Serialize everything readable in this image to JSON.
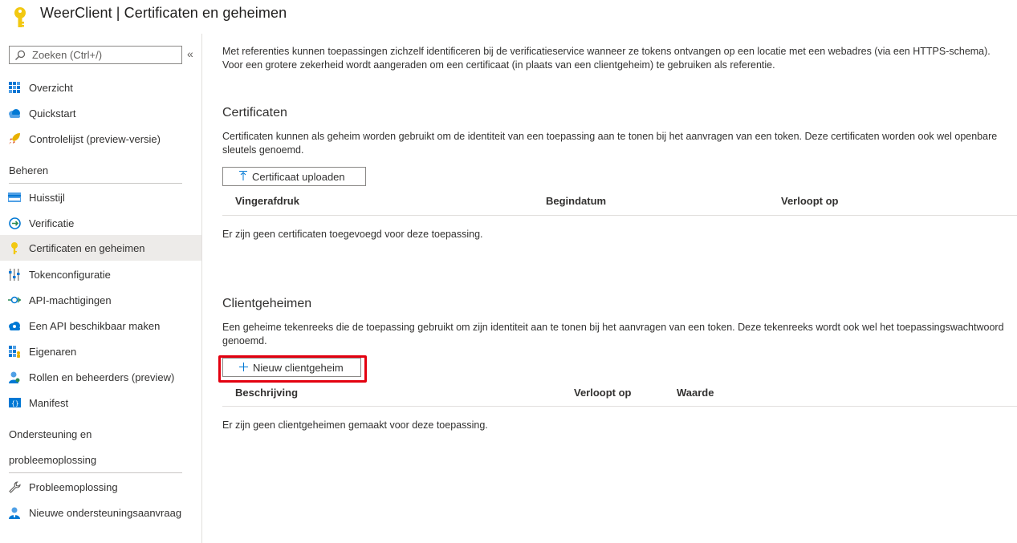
{
  "header": {
    "title": "WeerClient | Certificaten en geheimen",
    "icon": "key-icon",
    "icon_color": "#f2c811"
  },
  "sidebar": {
    "search_placeholder": "Zoeken (Ctrl+/)",
    "collapse_glyph": "«",
    "items_top": [
      {
        "label": "Overzicht",
        "icon": "grid-icon"
      },
      {
        "label": "Quickstart",
        "icon": "cloud-icon"
      },
      {
        "label": "Controlelijst (preview-versie)",
        "icon": "rocket-icon"
      }
    ],
    "section_manage": "Beheren",
    "items_manage": [
      {
        "label": "Huisstijl",
        "icon": "branding-icon"
      },
      {
        "label": "Verificatie",
        "icon": "verification-icon"
      },
      {
        "label": "Certificaten en geheimen",
        "icon": "key-icon",
        "active": true
      },
      {
        "label": "Tokenconfiguratie",
        "icon": "token-config-icon"
      },
      {
        "label": "API-machtigingen",
        "icon": "api-permissions-icon"
      },
      {
        "label": "Een API beschikbaar maken",
        "icon": "cloud-api-icon"
      },
      {
        "label": "Eigenaren",
        "icon": "owners-icon"
      },
      {
        "label": "Rollen en beheerders (preview)",
        "icon": "roles-icon"
      },
      {
        "label": "Manifest",
        "icon": "manifest-icon"
      }
    ],
    "section_support_line1": "Ondersteuning en",
    "section_support_line2": "probleemoplossing",
    "items_support": [
      {
        "label": "Probleemoplossing",
        "icon": "wrench-icon"
      },
      {
        "label": "Nieuwe ondersteuningsaanvraag",
        "icon": "support-person-icon"
      }
    ]
  },
  "main": {
    "intro": "Met referenties kunnen toepassingen zichzelf identificeren bij de verificatieservice wanneer ze tokens ontvangen op een locatie met een webadres (via een HTTPS-schema). Voor een grotere zekerheid wordt aangeraden om een certificaat (in plaats van een clientgeheim) te gebruiken als referentie.",
    "certificates": {
      "heading": "Certificaten",
      "description": "Certificaten kunnen als geheim worden gebruikt om de identiteit van een toepassing aan te tonen bij het aanvragen van een token. Deze certificaten worden ook wel openbare sleutels genoemd.",
      "upload_button": "Certificaat uploaden",
      "columns": [
        "Vingerafdruk",
        "Begindatum",
        "Verloopt op"
      ],
      "empty_text": "Er zijn geen certificaten toegevoegd voor deze toepassing."
    },
    "secrets": {
      "heading": "Clientgeheimen",
      "description": "Een geheime tekenreeks die de toepassing gebruikt om zijn identiteit aan te tonen bij het aanvragen van een token. Deze tekenreeks wordt ook wel het toepassingswachtwoord genoemd.",
      "new_button": "Nieuw clientgeheim",
      "columns": [
        "Beschrijving",
        "Verloopt op",
        "Waarde"
      ],
      "empty_text": "Er zijn geen clientgeheimen gemaakt voor deze toepassing."
    }
  },
  "colors": {
    "highlight": "#e3000f",
    "active_bg": "#edebe9",
    "accent_blue": "#0078d4"
  }
}
